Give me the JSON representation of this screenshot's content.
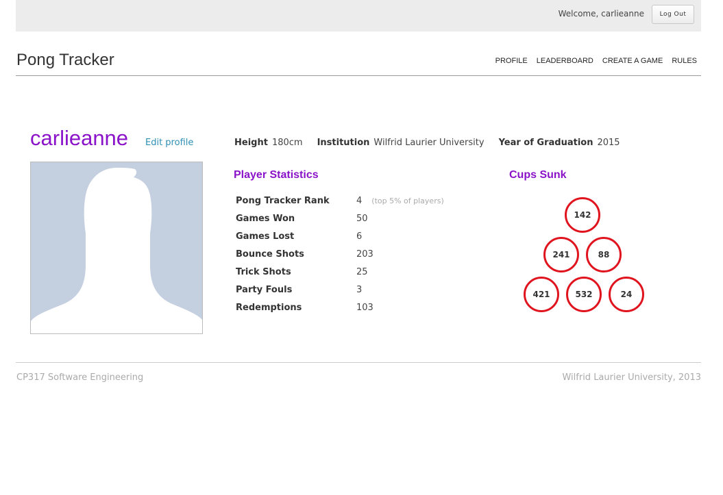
{
  "topbar": {
    "welcome": "Welcome, carlieanne",
    "logout_label": "Log Out"
  },
  "header": {
    "brand": "Pong Tracker",
    "nav": [
      "PROFILE",
      "LEADERBOARD",
      "CREATE A GAME",
      "RULES"
    ]
  },
  "profile": {
    "username": "carlieanne",
    "edit_label": "Edit profile",
    "height_label": "Height",
    "height_value": "180cm",
    "institution_label": "Institution",
    "institution_value": "Wilfrid Laurier University",
    "grad_label": "Year of Graduation",
    "grad_value": "2015"
  },
  "stats": {
    "title": "Player Statistics",
    "rank_note": "(top 5% of players)",
    "rows": [
      {
        "label": "Pong Tracker Rank",
        "value": "4"
      },
      {
        "label": "Games Won",
        "value": "50"
      },
      {
        "label": "Games Lost",
        "value": "6"
      },
      {
        "label": "Bounce Shots",
        "value": "203"
      },
      {
        "label": "Trick Shots",
        "value": "25"
      },
      {
        "label": "Party Fouls",
        "value": "3"
      },
      {
        "label": "Redemptions",
        "value": "103"
      }
    ]
  },
  "cups": {
    "title": "Cups Sunk",
    "values": [
      "142",
      "241",
      "88",
      "421",
      "532",
      "24"
    ]
  },
  "footer": {
    "left": "CP317 Software Engineering",
    "right": "Wilfrid Laurier University, 2013"
  },
  "colors": {
    "accent": "#8a12c8",
    "link": "#2e8fb4",
    "cup_ring": "#e0141e"
  }
}
